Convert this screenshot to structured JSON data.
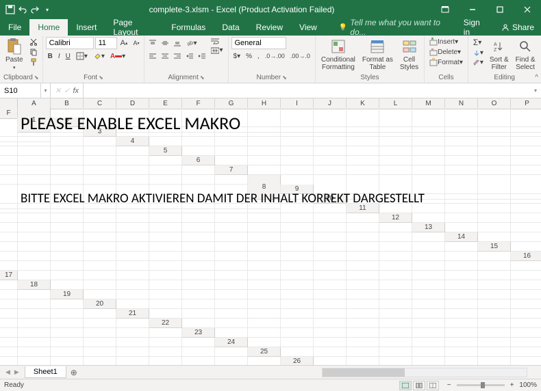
{
  "titlebar": {
    "filename": "complete-3.xlsm",
    "app": "Excel",
    "activation": "(Product Activation Failed)",
    "full_title": "complete-3.xlsm - Excel (Product Activation Failed)"
  },
  "ribbon_tabs": {
    "file": "File",
    "home": "Home",
    "insert": "Insert",
    "page_layout": "Page Layout",
    "formulas": "Formulas",
    "data": "Data",
    "review": "Review",
    "view": "View",
    "tell_me": "Tell me what you want to do...",
    "sign_in": "Sign in",
    "share": "Share"
  },
  "ribbon": {
    "clipboard": {
      "label": "Clipboard",
      "paste": "Paste"
    },
    "font": {
      "label": "Font",
      "name": "Calibri",
      "size": "11",
      "bold": "B",
      "italic": "I",
      "underline": "U"
    },
    "alignment": {
      "label": "Alignment",
      "wrap": "Wrap Text",
      "merge": "Merge & Center"
    },
    "number": {
      "label": "Number",
      "format": "General"
    },
    "styles": {
      "label": "Styles",
      "conditional": "Conditional\nFormatting",
      "format_table": "Format as\nTable",
      "cell_styles": "Cell\nStyles"
    },
    "cells": {
      "label": "Cells",
      "insert": "Insert",
      "delete": "Delete",
      "format": "Format"
    },
    "editing": {
      "label": "Editing",
      "sort_filter": "Sort &\nFilter",
      "find_select": "Find &\nSelect"
    }
  },
  "formula_bar": {
    "name_box": "S10",
    "fx": "fx",
    "formula": ""
  },
  "columns": [
    "A",
    "B",
    "C",
    "D",
    "E",
    "F",
    "G",
    "H",
    "I",
    "J",
    "K",
    "L",
    "M",
    "N",
    "O",
    "P",
    "F"
  ],
  "rows_visible": 26,
  "sheet_content": {
    "line1": "PLEASE ENABLE EXCEL MAKRO",
    "line2": "BITTE EXCEL MAKRO AKTIVIEREN DAMIT DER INHALT KORREKT DARGESTELLT"
  },
  "sheet_tabs": {
    "sheet1": "Sheet1"
  },
  "statusbar": {
    "ready": "Ready",
    "zoom": "100%"
  },
  "colors": {
    "brand": "#217346"
  }
}
